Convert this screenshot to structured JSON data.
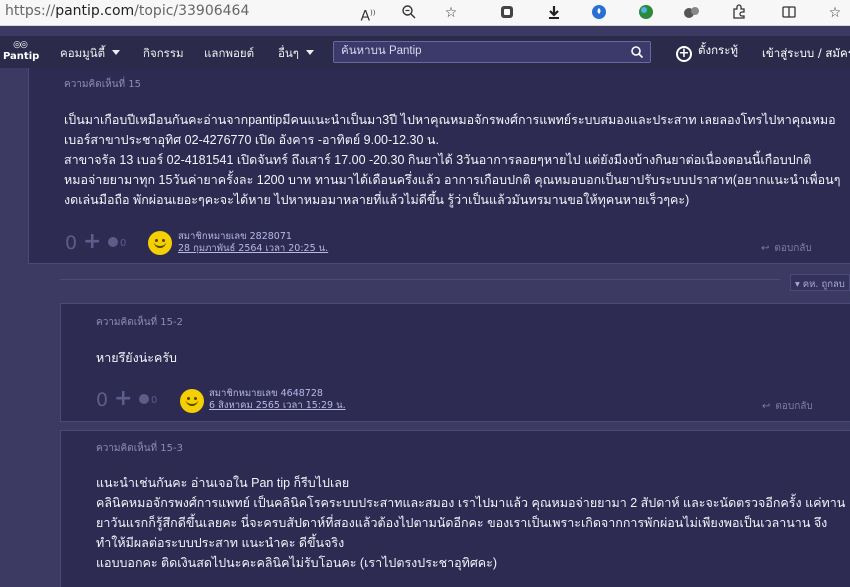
{
  "browser": {
    "url_prefix": "https://",
    "url_host": "pantip.com",
    "url_path": "/topic/33906464"
  },
  "nav": {
    "logo": "Pantip",
    "community": "คอมมูนิตี้",
    "activities": "กิจกรรม",
    "exchange": "แลกพอยต์",
    "others": "อื่นๆ",
    "search_placeholder": "ค้นหาบน Pantip",
    "write": "ตั้งกระทู้",
    "login": "เข้าสู่ระบบ / สมัครส"
  },
  "comment15": {
    "number": "ความคิดเห็นที่ 15",
    "lines": [
      "เป็นมาเกือบปีเหมือนกันคะอ่านจากpantipมีคนแนะนำเป็นมา3ปี ไปหาคุณหมอจักรพงศ์การแพทย์ระบบสมองและประสาท เลยลองโทรไปหาคุณหมอ",
      "เบอร์สาขาประชาอุทิศ 02-4276770 เปิด อังคาร -อาทิตย์ 9.00-12.30 น.",
      "สาขาจรัล 13 เบอร์ 02-4181541 เปิดจันทร์ ถึงเสาร์  17.00 -20.30 กินยาได้ 3วันอาการลอยๆหายไป แต่ยังมีงงบ้างกินยาต่อเนื่องตอนนี้เกือบปกติ",
      "หมอจ่ายยามาทุก 15วันค่ายาครั้งละ 1200 บาท ทานมาได้เดือนครึ่งแล้ว อาการเกือบปกติ คุณหมอบอกเป็นยาปรับระบบปราสาท(อยากแนะนำเพื่อนๆ",
      "งดเล่นมือถือ พักผ่อนเยอะๆคะจะได้หาย ไปหาหมอมาหลายที่แล้วไม่ดีขึ้น รู้ว่าเป็นแล้วมันทรมานขอให้ทุคนหายเร็วๆคะ)"
    ],
    "votes": "0",
    "emotions": "0",
    "member": "สมาชิกหมายเลข 2828071",
    "date": "28 กุมภาพันธ์ 2564 เวลา 20:25 น.",
    "reply": "ตอบกลับ"
  },
  "sort_label": "คห. ถูกลบ",
  "comment15_2": {
    "number": "ความคิดเห็นที่ 15-2",
    "text": "หายรึยังน่ะครับ",
    "votes": "0",
    "emotions": "0",
    "member": "สมาชิกหมายเลข 4648728",
    "date": "6 สิงหาคม 2565 เวลา 15:29 น.",
    "reply": "ตอบกลับ"
  },
  "comment15_3": {
    "number": "ความคิดเห็นที่ 15-3",
    "lines": [
      "แนะนำเช่นกันคะ อ่านเจอใน Pan tip ก็รีบไปเลย",
      "คลินิคหมอจักรพงศ์การแพทย์ เป็นคลินิคโรคระบบประสาทและสมอง เราไปมาแล้ว คุณหมอจ่ายยามา 2 สัปดาห์ และจะนัดตรวจอีกครั้ง แค่ทาน",
      "ยาวันแรกก็รู้สึกดีขึ้นเลยคะ นี่จะครบสัปดาห์ที่สองแล้วต้องไปตามนัดอีกคะ ของเราเป็นเพราะเกิดจากการพักผ่อนไม่เพียงพอเป็นเวลานาน จึง",
      "ทำให้มีผลต่อระบบประสาท แนะนำคะ ดีขึ้นจริง",
      "แอบบอกคะ ติดเงินสดไปนะคะคลินิคไม่รับโอนคะ (เราไปตรงประชาอุทิศคะ)"
    ]
  }
}
